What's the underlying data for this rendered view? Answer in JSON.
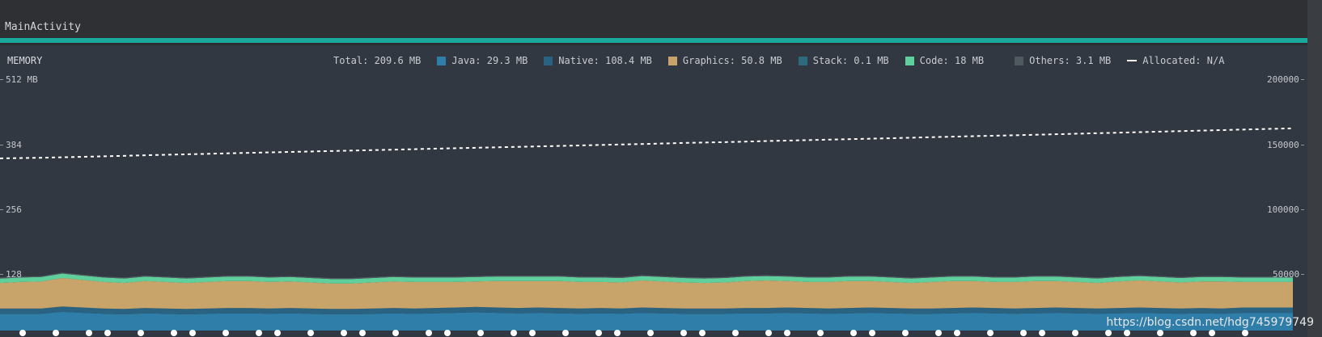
{
  "window": {
    "activity": "MainActivity"
  },
  "monitor": {
    "title": "MEMORY",
    "stats": {
      "total": "Total: 209.6 MB",
      "java": "Java: 29.3 MB",
      "native": "Native: 108.4 MB",
      "graphics": "Graphics: 50.8 MB",
      "stack": "Stack: 0.1 MB",
      "code": "Code: 18 MB",
      "others": "Others: 3.1 MB",
      "allocated": "Allocated: N/A"
    }
  },
  "colors": {
    "java": "#2f7da9",
    "native": "#2a6381",
    "graphics": "#c8a46a",
    "stack": "#2b6b7c",
    "code": "#5fcf9c",
    "others": "#4f5a60",
    "allocated": "#ffffff",
    "accent": "#18a99c"
  },
  "watermark": "https://blog.csdn.net/hdg745979749",
  "chart_data": {
    "type": "area",
    "left_axis": {
      "unit": "MB",
      "ticks": [
        "512 MB",
        "384",
        "256",
        "128"
      ],
      "ylim": [
        0,
        512
      ]
    },
    "right_axis": {
      "ticks": [
        "200000",
        "150000",
        "100000",
        "50000"
      ],
      "ylim": [
        0,
        200000
      ]
    },
    "series": [
      {
        "name": "Java",
        "values": [
          34,
          34,
          34,
          38,
          36,
          34,
          33,
          35,
          34,
          33,
          34,
          35,
          35,
          34,
          35,
          34,
          33,
          33,
          34,
          35,
          34,
          35,
          36,
          37,
          36,
          35,
          36,
          35,
          34,
          35,
          34,
          36,
          35,
          34,
          34,
          34,
          35,
          35,
          36,
          35,
          34,
          35,
          36,
          35,
          34,
          34,
          35,
          36,
          35,
          34,
          35,
          36,
          35,
          34,
          35,
          36,
          35,
          34,
          35,
          34,
          36
        ]
      },
      {
        "name": "Native",
        "values": [
          11,
          11,
          11,
          11,
          11,
          11,
          11,
          11,
          11,
          11,
          11,
          11,
          11,
          11,
          11,
          11,
          11,
          11,
          11,
          11,
          11,
          11,
          11,
          11,
          11,
          11,
          11,
          11,
          11,
          11,
          11,
          11,
          11,
          11,
          11,
          11,
          11,
          11,
          11,
          11,
          11,
          11,
          11,
          11,
          11,
          11,
          11,
          11,
          11,
          11,
          11,
          11,
          11,
          11,
          11,
          11,
          11,
          11,
          11,
          11,
          11
        ]
      },
      {
        "name": "Graphics",
        "values": [
          52,
          54,
          55,
          58,
          56,
          54,
          53,
          55,
          54,
          53,
          54,
          55,
          55,
          54,
          54,
          53,
          52,
          52,
          53,
          54,
          54,
          53,
          52,
          52,
          54,
          55,
          54,
          55,
          54,
          53,
          53,
          55,
          54,
          53,
          52,
          53,
          55,
          56,
          54,
          53,
          54,
          55,
          54,
          53,
          52,
          54,
          55,
          54,
          53,
          54,
          55,
          54,
          53,
          52,
          54,
          55,
          54,
          53,
          54,
          55,
          52
        ]
      },
      {
        "name": "Code",
        "values": [
          9,
          9,
          9,
          9,
          9,
          9,
          9,
          9,
          9,
          9,
          9,
          9,
          9,
          9,
          9,
          9,
          9,
          9,
          9,
          9,
          9,
          9,
          9,
          9,
          9,
          9,
          9,
          9,
          9,
          9,
          9,
          9,
          9,
          9,
          9,
          9,
          9,
          9,
          9,
          9,
          9,
          9,
          9,
          9,
          9,
          9,
          9,
          9,
          9,
          9,
          9,
          9,
          9,
          9,
          9,
          9,
          9,
          9,
          9,
          9,
          9
        ]
      },
      {
        "name": "Others",
        "values": [
          2,
          2,
          2,
          2,
          2,
          2,
          2,
          2,
          2,
          2,
          2,
          2,
          2,
          2,
          2,
          2,
          2,
          2,
          2,
          2,
          2,
          2,
          2,
          2,
          2,
          2,
          2,
          2,
          2,
          2,
          2,
          2,
          2,
          2,
          2,
          2,
          2,
          2,
          2,
          2,
          2,
          2,
          2,
          2,
          2,
          2,
          2,
          2,
          2,
          2,
          2,
          2,
          2,
          2,
          2,
          2,
          2,
          2,
          2,
          2,
          2
        ]
      }
    ],
    "allocated_line": [
      137000,
      137500,
      138200,
      139000,
      139800,
      140500,
      141300,
      142000,
      142700,
      143400,
      144100,
      144900,
      145600,
      146300,
      147000,
      147800,
      148500,
      149300,
      150000,
      150800,
      151500,
      152300,
      153000,
      153800,
      154600,
      155300,
      156100,
      156900,
      157700,
      158500,
      159300,
      160100,
      160900
    ]
  }
}
